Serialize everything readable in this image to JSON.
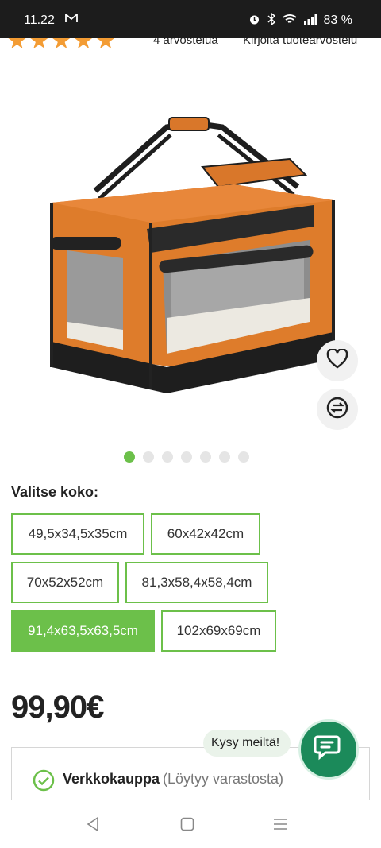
{
  "status_bar": {
    "time": "11.22",
    "battery": "83 %",
    "icons": [
      "gmail-icon",
      "alarm-icon",
      "bluetooth-icon",
      "wifi-icon",
      "signal-icon"
    ]
  },
  "reviews": {
    "stars": "★★★★★",
    "rating_stars": 5,
    "count_link": "4 arvostelua",
    "write_link": "Kirjoita tuotearvostelu"
  },
  "gallery": {
    "image_count": 7,
    "active_index": 0
  },
  "size_selector": {
    "label": "Valitse koko:",
    "options": [
      "49,5x34,5x35cm",
      "60x42x42cm",
      "70x52x52cm",
      "81,3x58,4x58,4cm",
      "91,4x63,5x63,5cm",
      "102x69x69cm"
    ],
    "selected": "91,4x63,5x63,5cm"
  },
  "price": "99,90€",
  "stock": {
    "title": "Verkkokauppa",
    "status": "(Löytyy varastosta)"
  },
  "chat": {
    "label": "Kysy meiltä!"
  },
  "colors": {
    "accent": "#6cc04a",
    "stars": "#f39c34",
    "chat": "#1b8a5a"
  }
}
